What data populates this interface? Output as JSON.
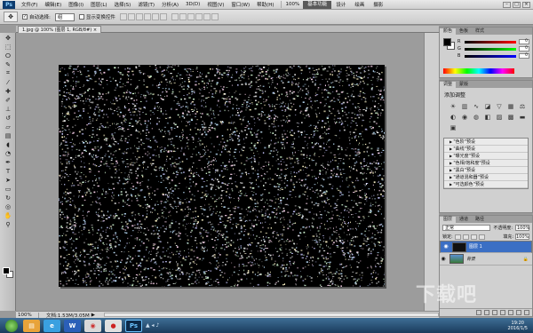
{
  "menubar": {
    "logo": "Ps",
    "items": [
      "文件(F)",
      "编辑(E)",
      "图像(I)",
      "图层(L)",
      "选择(S)",
      "滤镜(T)",
      "分析(A)",
      "3D(D)",
      "视图(V)",
      "窗口(W)",
      "帮助(H)"
    ],
    "zoom": "100%",
    "workspace_active": "基本功能",
    "workspace_links": [
      "设计",
      "绘画",
      "摄影"
    ]
  },
  "options": {
    "auto_select_label": "自动选择:",
    "auto_select_value": "组",
    "show_transform_label": "显示变换控件"
  },
  "document": {
    "tab_title": "1.jpg @ 100% (图层 1, RGB/8#) ×"
  },
  "status": {
    "zoom": "100%",
    "doc_info": "文档:1.53M/3.05M"
  },
  "color_panel": {
    "tabs": [
      "颜色",
      "色板",
      "样式"
    ],
    "channels": [
      {
        "label": "R",
        "value": "0"
      },
      {
        "label": "G",
        "value": "0"
      },
      {
        "label": "B",
        "value": "0"
      }
    ]
  },
  "adjustments": {
    "tabs": [
      "调整",
      "蒙版"
    ],
    "title": "添加调整",
    "presets": [
      "\"色阶\"预设",
      "\"曲线\"预设",
      "\"曝光度\"预设",
      "\"色相/饱和度\"预设",
      "\"黑白\"预设",
      "\"通道混和器\"预设",
      "\"可选颜色\"预设"
    ]
  },
  "layers": {
    "tabs": [
      "图层",
      "通道",
      "路径"
    ],
    "blend_mode": "正常",
    "opacity_label": "不透明度:",
    "opacity_value": "100%",
    "lock_label": "锁定:",
    "fill_label": "填充:",
    "fill_value": "100%",
    "items": [
      {
        "name": "图层 1",
        "selected": true
      },
      {
        "name": "背景",
        "selected": false
      }
    ]
  },
  "taskbar": {
    "time": "19:20",
    "date": "2016/1/5"
  },
  "watermark": "下载吧",
  "colors": {
    "selection": "#3b6fc4",
    "canvas": "#000000",
    "workspace": "#9c9c9c"
  }
}
